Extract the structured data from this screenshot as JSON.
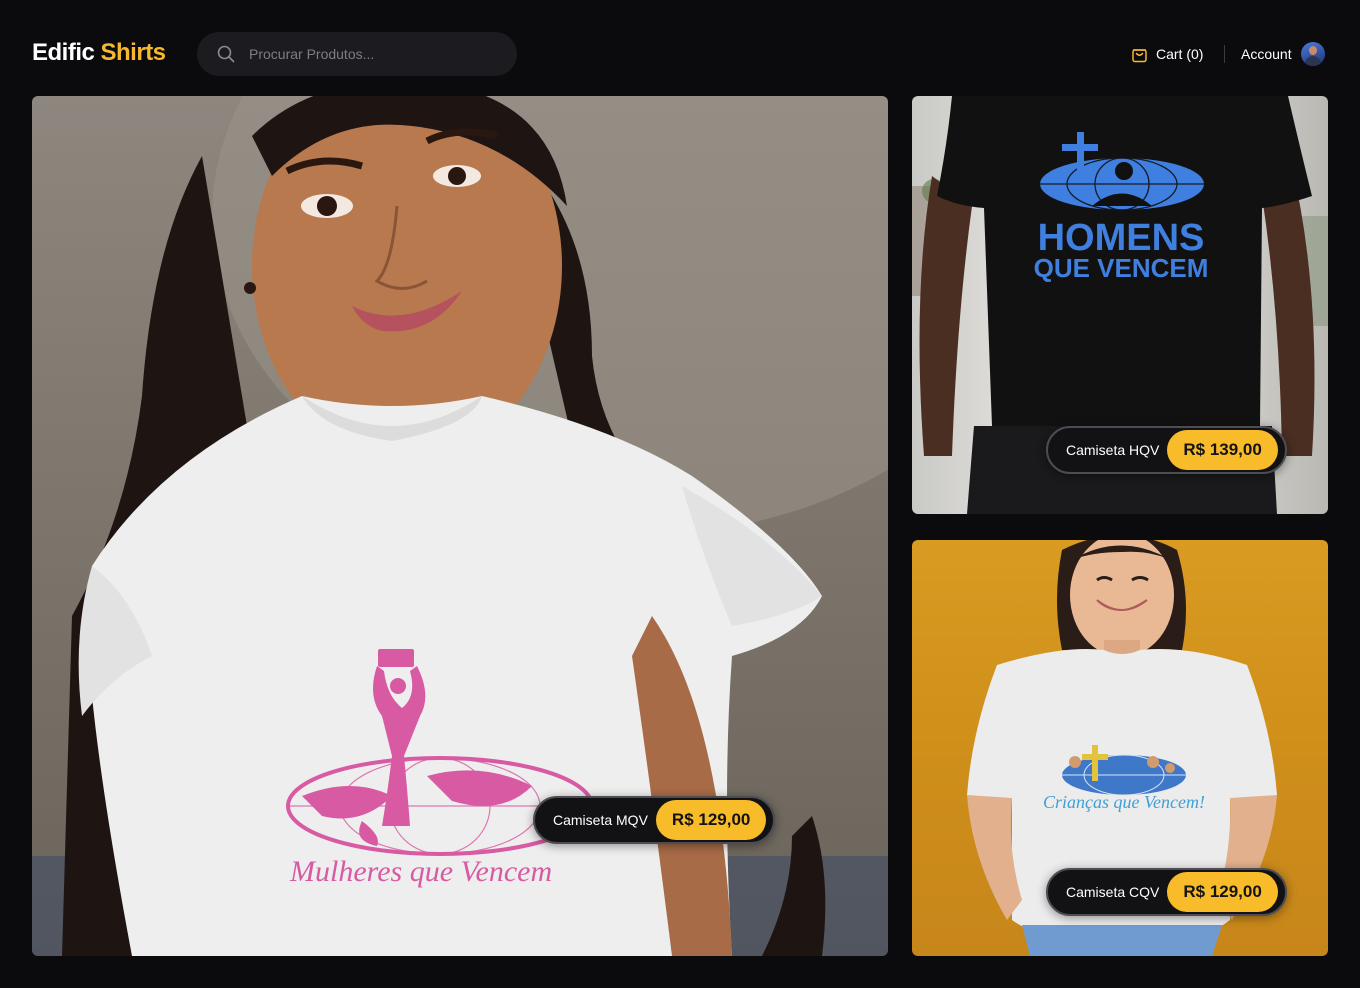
{
  "brand": {
    "name_part1": "Edific",
    "name_part2": "Shirts",
    "accent_color": "#f5b82e"
  },
  "search": {
    "placeholder": "Procurar Produtos...",
    "value": "",
    "icon": "search-icon"
  },
  "nav": {
    "cart_label": "Cart (0)",
    "cart_icon": "shopping-bag-icon",
    "account_label": "Account",
    "avatar_icon": "user-avatar"
  },
  "products": [
    {
      "name": "Camiseta MQV",
      "price": "R$ 129,00",
      "shirt_print": "Mulheres que Vencem",
      "shirt_color": "white"
    },
    {
      "name": "Camiseta HQV",
      "price": "R$ 139,00",
      "shirt_print_line1": "HOMENS",
      "shirt_print_line2": "QUE VENCEM",
      "shirt_color": "black"
    },
    {
      "name": "Camiseta CQV",
      "price": "R$ 129,00",
      "shirt_print": "Crianças que Vencem!",
      "shirt_color": "white"
    }
  ],
  "colors": {
    "background": "#0b0b0e",
    "price_pill": "#f8bb2a",
    "pill_background": "#121214"
  }
}
